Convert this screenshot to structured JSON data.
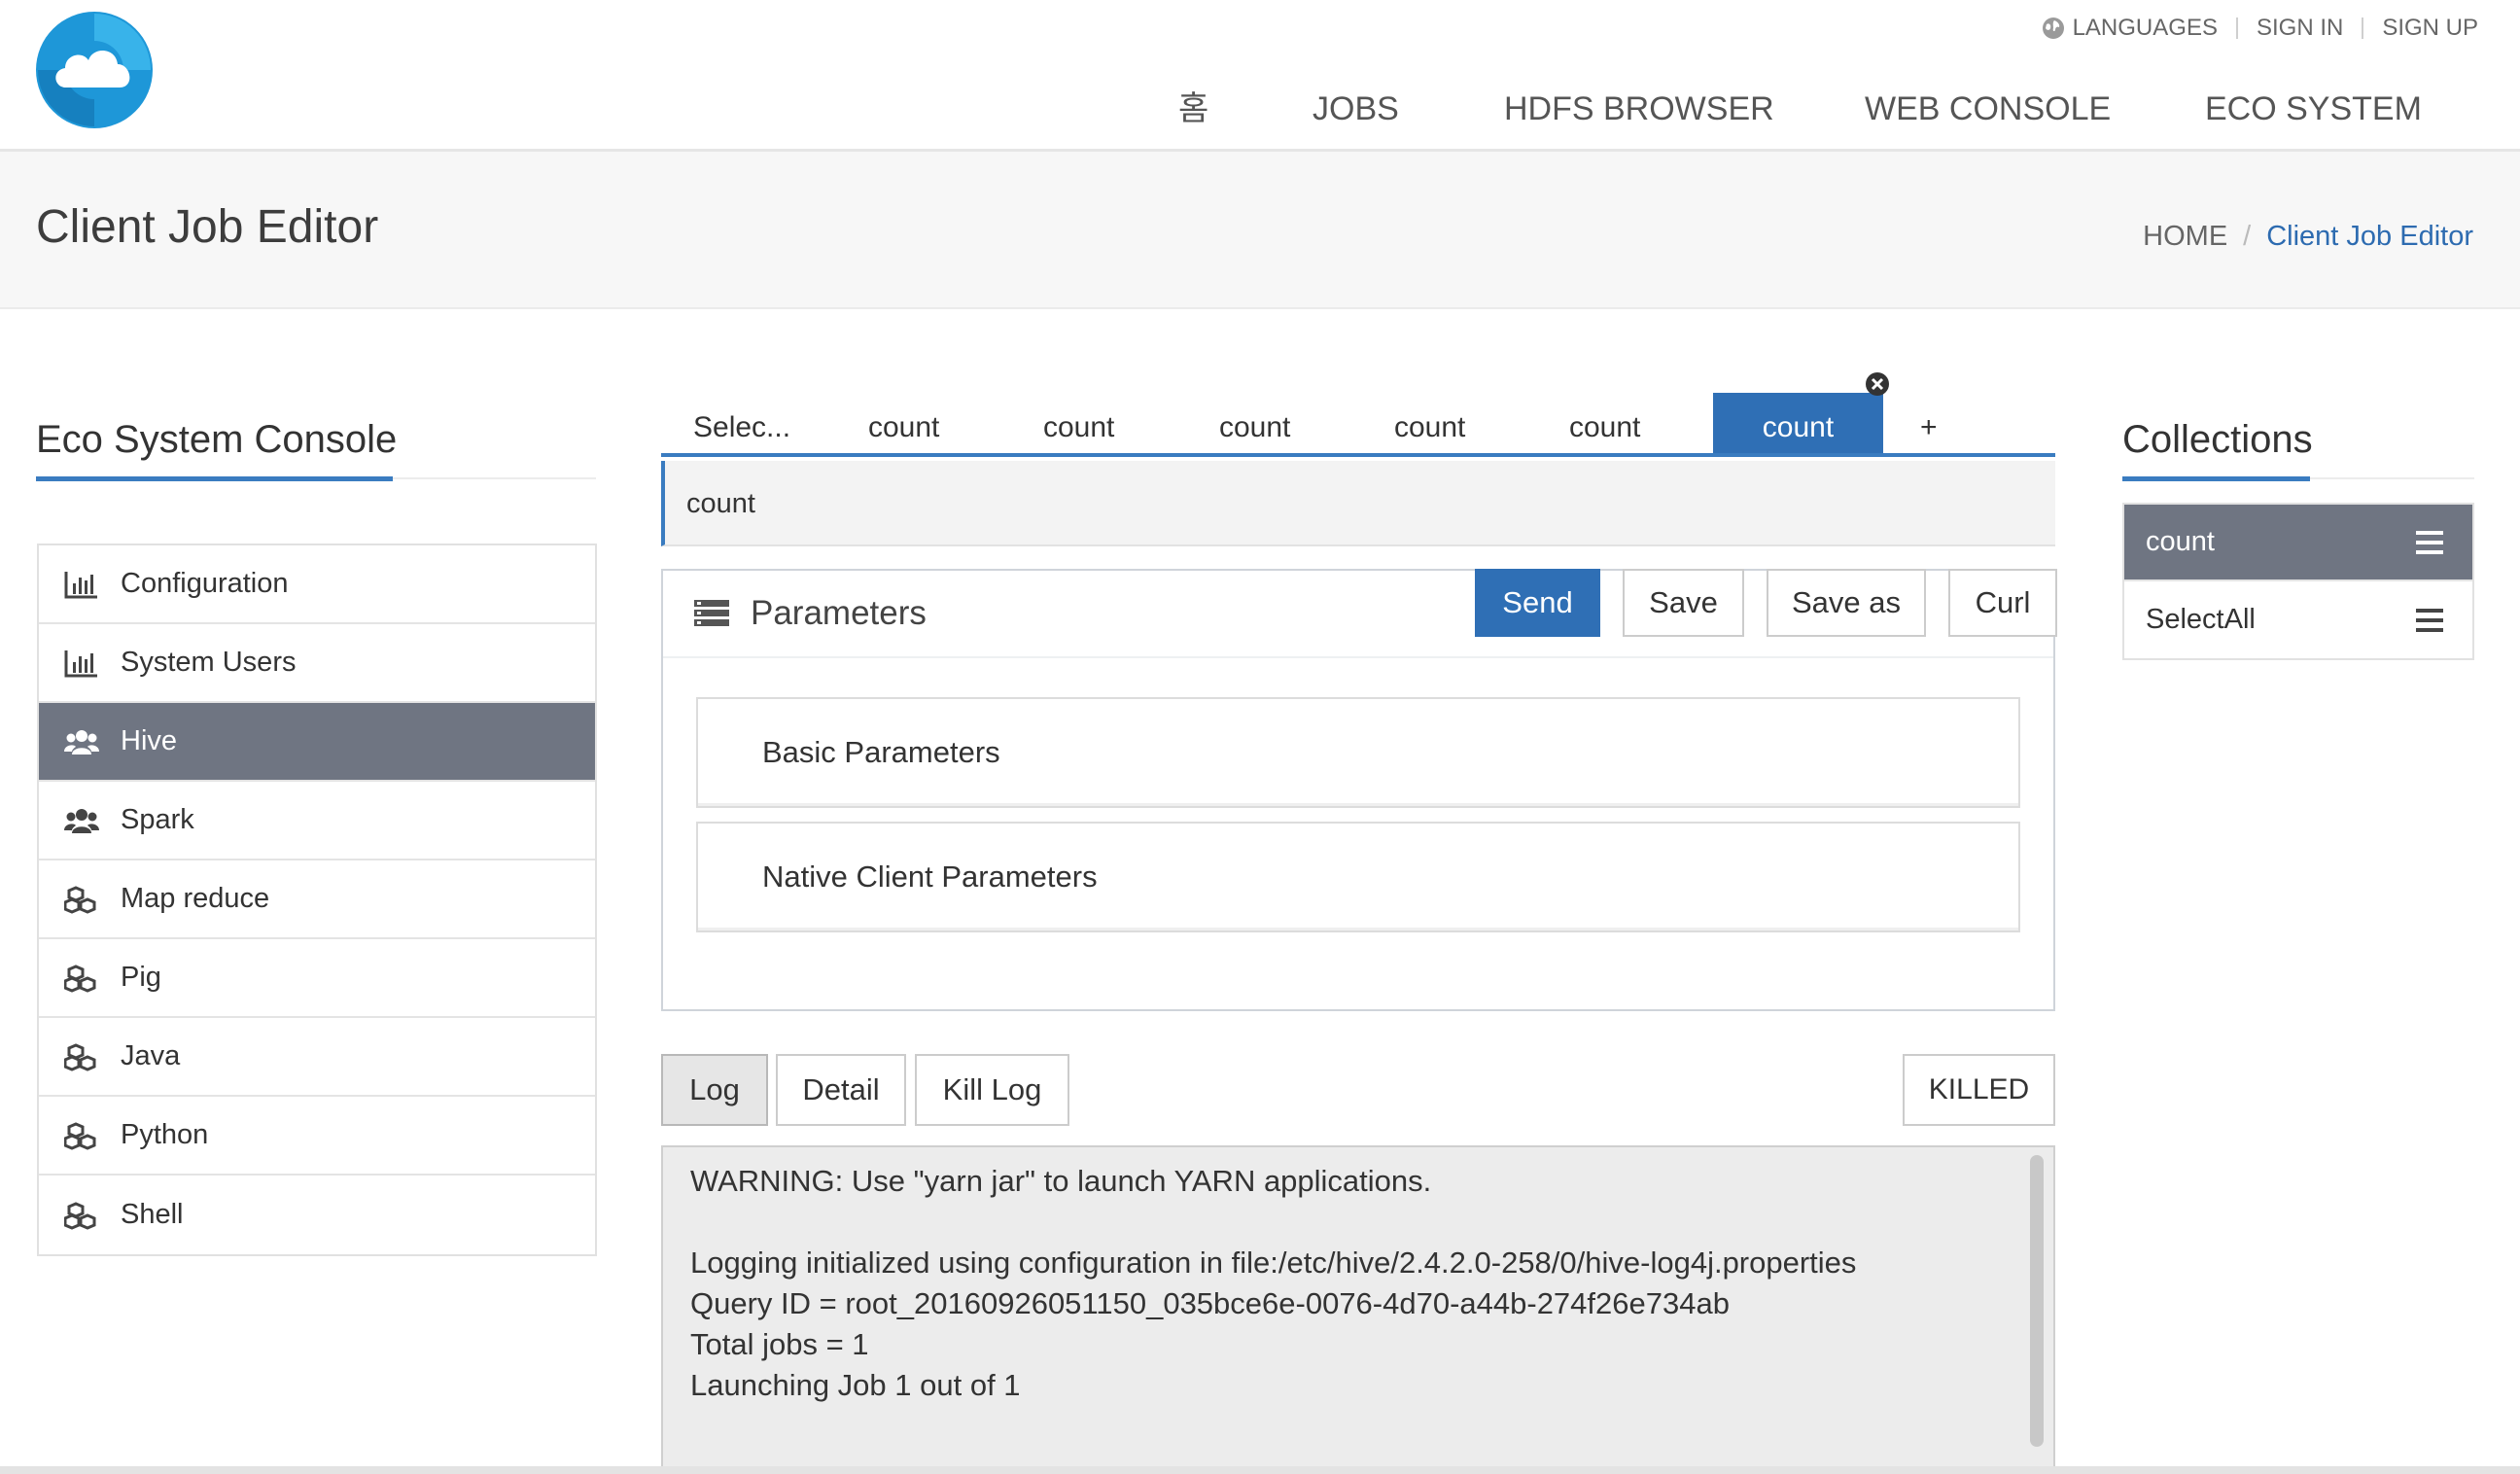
{
  "header": {
    "top_links": [
      "LANGUAGES",
      "SIGN IN",
      "SIGN UP"
    ],
    "nav": [
      "홈",
      "JOBS",
      "HDFS BROWSER",
      "WEB CONSOLE",
      "ECO SYSTEM"
    ]
  },
  "title_band": {
    "title": "Client Job Editor",
    "breadcrumb": [
      "HOME",
      "Client Job Editor"
    ]
  },
  "sidebar": {
    "title": "Eco System Console",
    "items": [
      {
        "label": "Configuration",
        "icon": "bar-chart-icon"
      },
      {
        "label": "System Users",
        "icon": "bar-chart-icon"
      },
      {
        "label": "Hive",
        "icon": "users-icon",
        "active": true
      },
      {
        "label": "Spark",
        "icon": "users-icon"
      },
      {
        "label": "Map reduce",
        "icon": "cubes-icon"
      },
      {
        "label": "Pig",
        "icon": "cubes-icon"
      },
      {
        "label": "Java",
        "icon": "cubes-icon"
      },
      {
        "label": "Python",
        "icon": "cubes-icon"
      },
      {
        "label": "Shell",
        "icon": "cubes-icon"
      }
    ]
  },
  "editor": {
    "tabs": [
      "Selec...",
      "count",
      "count",
      "count",
      "count",
      "count",
      "count",
      "+"
    ],
    "active_tab": 6,
    "job_name": "count",
    "params_title": "Parameters",
    "buttons": {
      "send": "Send",
      "save": "Save",
      "save_as": "Save as",
      "curl": "Curl"
    },
    "sections": [
      "Basic Parameters",
      "Native Client Parameters"
    ]
  },
  "log": {
    "buttons": {
      "log": "Log",
      "detail": "Detail",
      "kill_log": "Kill Log"
    },
    "status": "KILLED",
    "lines": [
      "WARNING: Use \"yarn jar\" to launch YARN applications.",
      "",
      "Logging initialized using configuration in file:/etc/hive/2.4.2.0-258/0/hive-log4j.properties",
      "Query ID = root_20160926051150_035bce6e-0076-4d70-a44b-274f26e734ab",
      "Total jobs = 1",
      "Launching Job 1 out of 1"
    ]
  },
  "collections": {
    "title": "Collections",
    "items": [
      {
        "label": "count",
        "active": true
      },
      {
        "label": "SelectAll"
      }
    ]
  },
  "colors": {
    "accent": "#2f6fb5",
    "active_menu": "#6f7582",
    "link": "#2d6bb0"
  }
}
